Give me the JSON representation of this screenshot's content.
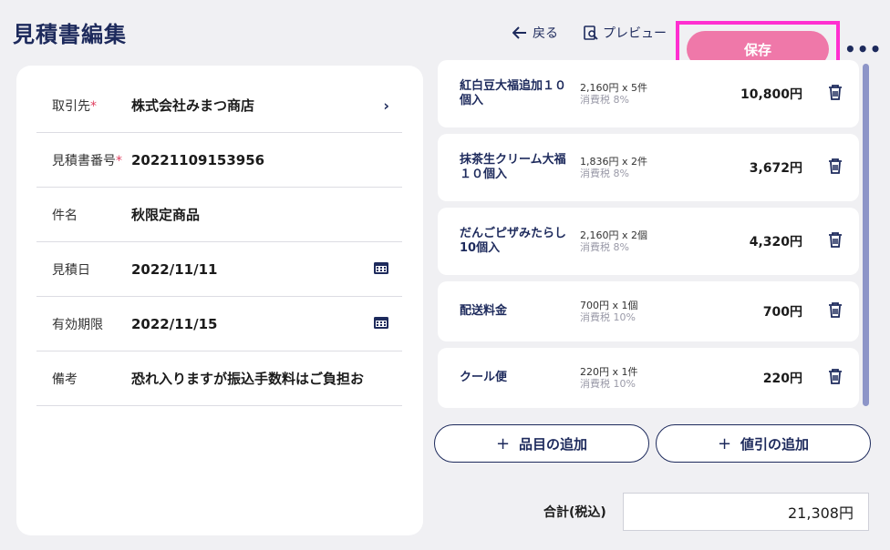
{
  "header": {
    "title": "見積書編集",
    "back_label": "戻る",
    "preview_label": "プレビュー",
    "save_label": "保存",
    "more_label": "•••"
  },
  "form": {
    "client": {
      "label": "取引先",
      "required": "*",
      "value": "株式会社みまつ商店"
    },
    "estimate_no": {
      "label": "見積書番号",
      "required": "*",
      "value": "20221109153956"
    },
    "subject": {
      "label": "件名",
      "value": "秋限定商品"
    },
    "estimate_date": {
      "label": "見積日",
      "value": "2022/11/11"
    },
    "valid_until": {
      "label": "有効期限",
      "value": "2022/11/15"
    },
    "notes": {
      "label": "備考",
      "value": "恐れ入りますが振込手数料はご負担お"
    }
  },
  "items": [
    {
      "name": "紅白豆大福追加１０個入",
      "qty": "2,160円 x 5件",
      "tax": "消費税 8%",
      "price": "10,800円"
    },
    {
      "name": "抹茶生クリーム大福１０個入",
      "qty": "1,836円 x 2件",
      "tax": "消費税 8%",
      "price": "3,672円"
    },
    {
      "name": "だんごピザみたらし10個入",
      "qty": "2,160円 x 2個",
      "tax": "消費税 8%",
      "price": "4,320円"
    },
    {
      "name": "配送料金",
      "qty": "700円 x 1個",
      "tax": "消費税 10%",
      "price": "700円"
    },
    {
      "name": "クール便",
      "qty": "220円 x 1件",
      "tax": "消費税 10%",
      "price": "220円"
    }
  ],
  "actions": {
    "plus": "+",
    "add_item": "品目の追加",
    "add_discount": "値引の追加"
  },
  "total": {
    "label": "合計(税込)",
    "value": "21,308円"
  },
  "colors": {
    "accent": "#ef78a9",
    "navy": "#1d2a5c",
    "highlight": "#ff2fd0"
  }
}
